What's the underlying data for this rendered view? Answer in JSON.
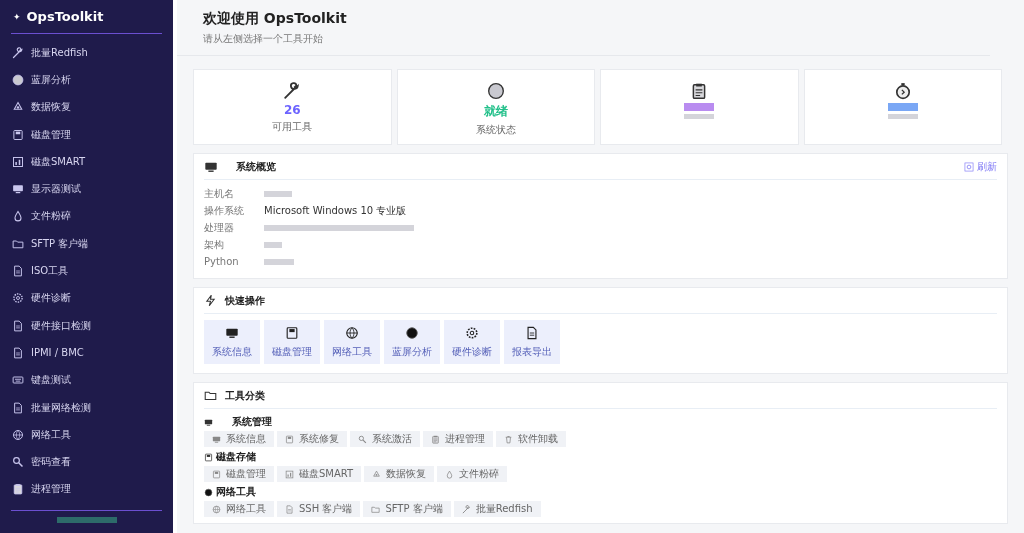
{
  "sidebar": {
    "logo": "✦",
    "title": "OpsToolkit",
    "items": [
      {
        "label": "批量Redfish",
        "selected": false
      },
      {
        "label": "蓝屏分析",
        "selected": false
      },
      {
        "label": "数据恢复",
        "selected": false
      },
      {
        "label": "磁盘管理",
        "selected": false
      },
      {
        "label": "磁盘SMART",
        "selected": false
      },
      {
        "label": "显示器测试",
        "selected": false
      },
      {
        "label": "文件粉碎",
        "selected": false
      },
      {
        "label": "SFTP 客户端",
        "selected": false
      },
      {
        "label": "ISO工具",
        "selected": false
      },
      {
        "label": "硬件诊断",
        "selected": false
      },
      {
        "label": "硬件接口检测",
        "selected": false
      },
      {
        "label": "IPMI / BMC",
        "selected": false
      },
      {
        "label": "键盘测试",
        "selected": false
      },
      {
        "label": "批量网络检测",
        "selected": false
      },
      {
        "label": "网络工具",
        "selected": false
      },
      {
        "label": "密码查看",
        "selected": false
      },
      {
        "label": "进程管理",
        "selected": false
      }
    ]
  },
  "header": {
    "title": "欢迎使用 OpsToolkit",
    "subtitle": "请从左侧选择一个工具开始"
  },
  "stats": [
    {
      "value": "26",
      "label": "可用工具",
      "color": "#6c63ff"
    },
    {
      "value": "就绪",
      "label": "系统状态",
      "color": "#22c08a"
    },
    {
      "color": "#b98cf0"
    },
    {
      "color": "#7aa7f5"
    }
  ],
  "overview": {
    "title": "系统概览",
    "refresh": "刷新",
    "rows": [
      {
        "key": "主机名"
      },
      {
        "key": "操作系统",
        "value": "Microsoft Windows 10 专业版"
      },
      {
        "key": "处理器"
      },
      {
        "key": "架构"
      },
      {
        "key": "Python"
      }
    ]
  },
  "quick_actions": {
    "title": "快速操作",
    "items": [
      "系统信息",
      "磁盘管理",
      "网络工具",
      "蓝屏分析",
      "硬件诊断",
      "报表导出"
    ]
  },
  "categories": {
    "title": "工具分类",
    "groups": [
      {
        "name": "系统管理",
        "tools": [
          "系统信息",
          "系统修复",
          "系统激活",
          "进程管理",
          "软件卸载"
        ]
      },
      {
        "name": "磁盘存储",
        "tools": [
          "磁盘管理",
          "磁盘SMART",
          "数据恢复",
          "文件粉碎"
        ]
      },
      {
        "name": "网络工具",
        "tools": [
          "网络工具",
          "SSH 客户端",
          "SFTP 客户端",
          "批量Redfish"
        ]
      }
    ]
  }
}
